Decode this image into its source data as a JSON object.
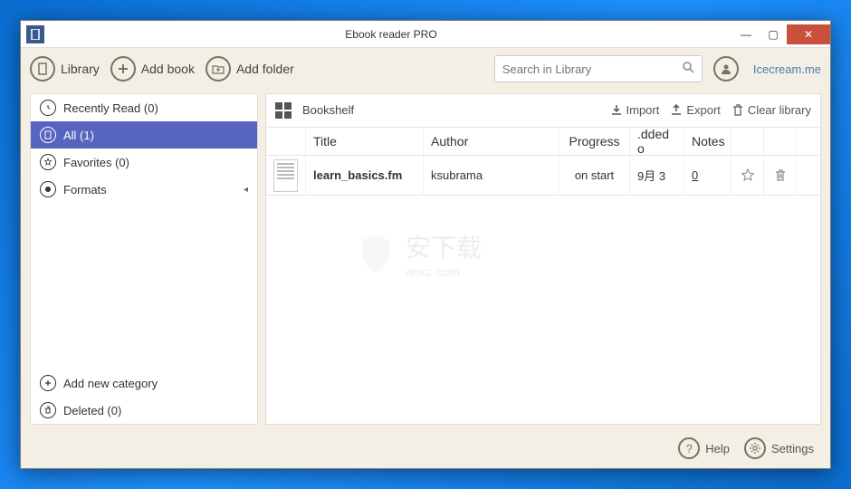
{
  "window": {
    "title": "Ebook reader PRO"
  },
  "toolbar": {
    "library": "Library",
    "add_book": "Add book",
    "add_folder": "Add folder",
    "search_placeholder": "Search in Library",
    "me_link": "Icecream.me"
  },
  "sidebar": {
    "recently_read": "Recently Read (0)",
    "all": "All (1)",
    "favorites": "Favorites (0)",
    "formats": "Formats",
    "add_category": "Add new category",
    "deleted": "Deleted (0)"
  },
  "main": {
    "bookshelf": "Bookshelf",
    "import": "Import",
    "export": "Export",
    "clear": "Clear library",
    "columns": {
      "title": "Title",
      "author": "Author",
      "progress": "Progress",
      "added": ".dded o",
      "notes": "Notes"
    },
    "row": {
      "title": "learn_basics.fm",
      "author": "ksubrama",
      "progress": "on start",
      "added": "9月 3",
      "notes": "0"
    }
  },
  "footer": {
    "help": "Help",
    "settings": "Settings"
  },
  "watermark": {
    "text": "安下载",
    "sub": "anxz.com"
  }
}
